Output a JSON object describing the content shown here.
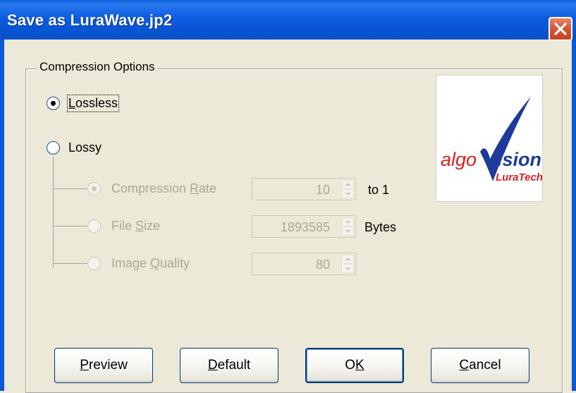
{
  "window": {
    "title": "Save as LuraWave.jp2"
  },
  "group": {
    "label": "Compression Options"
  },
  "options": {
    "lossless_label": "Lossless",
    "lossless_checked": true,
    "lossy_label": "Lossy",
    "lossy_checked": false
  },
  "lossy_settings": {
    "compression_rate": {
      "label": "Compression Rate",
      "value": "10",
      "unit": "to 1",
      "checked": true,
      "enabled": false
    },
    "file_size": {
      "label": "File Size",
      "value": "1893585",
      "unit": "Bytes",
      "checked": false,
      "enabled": false
    },
    "image_quality": {
      "label": "Image Quality",
      "value": "80",
      "unit": "",
      "checked": false,
      "enabled": false
    }
  },
  "logo": {
    "brand": "algoVision",
    "sub": "LuraTech"
  },
  "buttons": {
    "preview": "Preview",
    "default": "Default",
    "ok": "OK",
    "cancel": "Cancel"
  },
  "colors": {
    "titlebar": "#0a5bd8",
    "logo_red": "#d8201e",
    "logo_blue": "#1e3a9a"
  }
}
